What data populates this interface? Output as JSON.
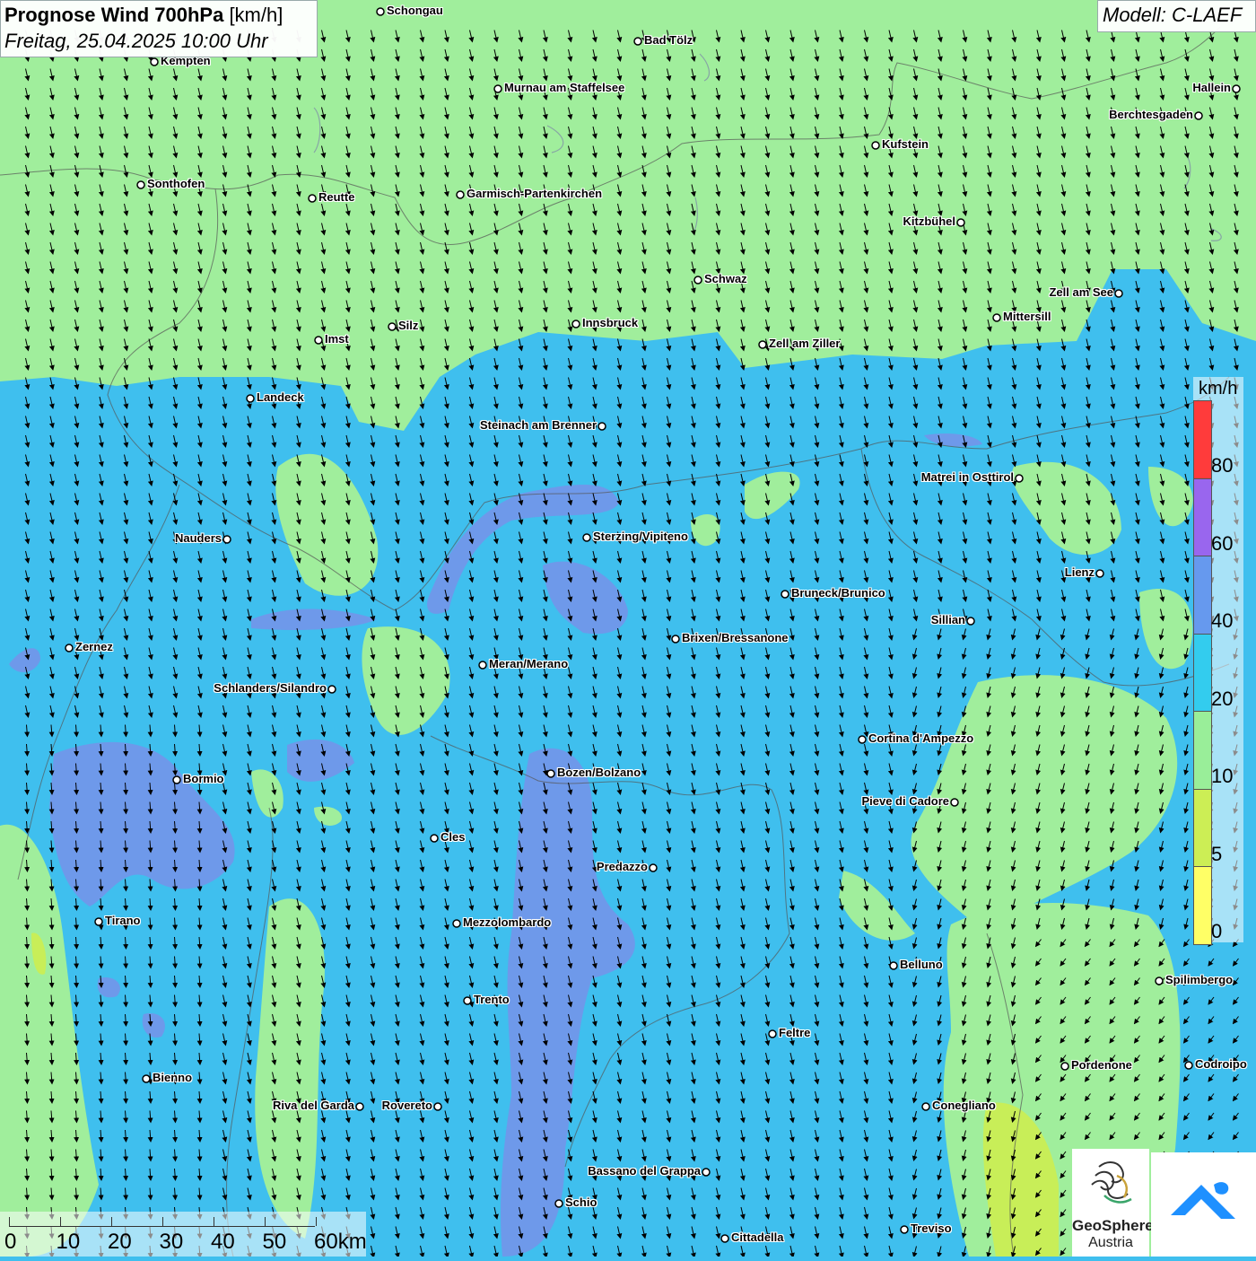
{
  "title": {
    "bold": "Prognose Wind 700hPa",
    "unit": "[km/h]",
    "datetime": "Freitag, 25.04.2025 10:00 Uhr"
  },
  "model": "Modell: C-LAEF",
  "legend": {
    "unit": "km/h",
    "labels": [
      "80",
      "60",
      "40",
      "20",
      "10",
      "5",
      "0"
    ],
    "colors": [
      "#ff3b3b",
      "#9966ee",
      "#6699ee",
      "#33ccee",
      "#99ee99",
      "#ccee55",
      "#ffff66"
    ]
  },
  "scalebar": {
    "labels": [
      "0",
      "10",
      "20",
      "30",
      "40",
      "50",
      "60km"
    ]
  },
  "logos": {
    "geosphere_line1": "GeoSphere",
    "geosphere_line2": "Austria"
  },
  "colors": {
    "band_lt10": "#a0ee9c",
    "band_10_20": "#3fbfee",
    "band_20_40": "#6e99ea",
    "band_5_10": "#c8ee58",
    "water": "#99bbff"
  },
  "cities": [
    {
      "name": "Schongau",
      "side": "right"
    },
    {
      "name": "Bad Tölz",
      "side": "right"
    },
    {
      "name": "Kempten",
      "side": "right"
    },
    {
      "name": "Murnau am Staffelsee",
      "side": "right"
    },
    {
      "name": "Hallein",
      "side": "left"
    },
    {
      "name": "Berchtesgaden",
      "side": "left"
    },
    {
      "name": "Kufstein",
      "side": "right"
    },
    {
      "name": "Sonthofen",
      "side": "right"
    },
    {
      "name": "Reutte",
      "side": "right"
    },
    {
      "name": "Garmisch-Partenkirchen",
      "side": "right"
    },
    {
      "name": "Kitzbühel",
      "side": "left"
    },
    {
      "name": "Schwaz",
      "side": "right"
    },
    {
      "name": "Zell am See",
      "side": "left"
    },
    {
      "name": "Mittersill",
      "side": "right"
    },
    {
      "name": "Innsbruck",
      "side": "right"
    },
    {
      "name": "Silz",
      "side": "right"
    },
    {
      "name": "Imst",
      "side": "right"
    },
    {
      "name": "Zell am Ziller",
      "side": "right"
    },
    {
      "name": "Landeck",
      "side": "right"
    },
    {
      "name": "Steinach am Brenner",
      "side": "left"
    },
    {
      "name": "Matrei in Osttirol",
      "side": "left"
    },
    {
      "name": "Nauders",
      "side": "left"
    },
    {
      "name": "Sterzing/Vipiteno",
      "side": "right"
    },
    {
      "name": "Lienz",
      "side": "left"
    },
    {
      "name": "Bruneck/Brunico",
      "side": "right"
    },
    {
      "name": "Sillian",
      "side": "left"
    },
    {
      "name": "Zernez",
      "side": "right"
    },
    {
      "name": "Brixen/Bressanone",
      "side": "right"
    },
    {
      "name": "Meran/Merano",
      "side": "right"
    },
    {
      "name": "Schlanders/Silandro",
      "side": "left"
    },
    {
      "name": "Cortina d'Ampezzo",
      "side": "right"
    },
    {
      "name": "Bozen/Bolzano",
      "side": "right"
    },
    {
      "name": "Bormio",
      "side": "right"
    },
    {
      "name": "Pieve di Cadore",
      "side": "left"
    },
    {
      "name": "Cles",
      "side": "right"
    },
    {
      "name": "Predazzo",
      "side": "left"
    },
    {
      "name": "Tirano",
      "side": "right"
    },
    {
      "name": "Mezzolombardo",
      "side": "right"
    },
    {
      "name": "Belluno",
      "side": "right"
    },
    {
      "name": "Spilimbergo",
      "side": "right"
    },
    {
      "name": "Trento",
      "side": "right"
    },
    {
      "name": "Feltre",
      "side": "right"
    },
    {
      "name": "Pordenone",
      "side": "right"
    },
    {
      "name": "Codroipo",
      "side": "right"
    },
    {
      "name": "Bienno",
      "side": "right"
    },
    {
      "name": "Riva del Garda",
      "side": "left"
    },
    {
      "name": "Rovereto",
      "side": "left"
    },
    {
      "name": "Conegliano",
      "side": "right"
    },
    {
      "name": "Bassano del Grappa",
      "side": "left"
    },
    {
      "name": "Schio",
      "side": "right"
    },
    {
      "name": "Treviso",
      "side": "right"
    },
    {
      "name": "Cittadella",
      "side": "right"
    }
  ]
}
